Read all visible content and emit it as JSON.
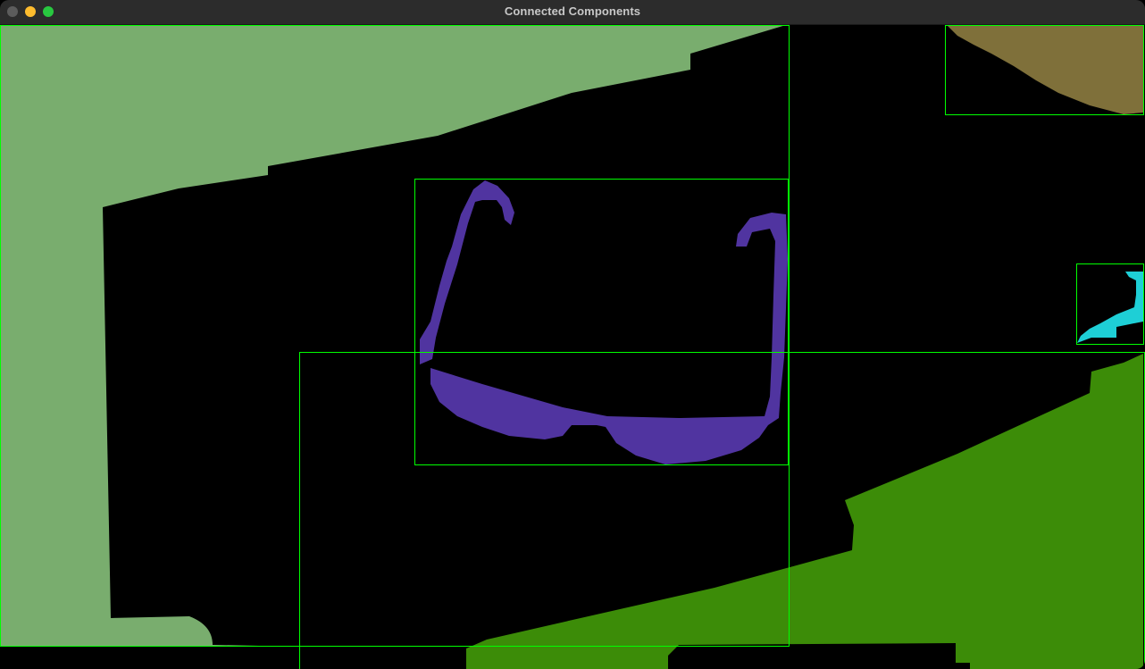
{
  "window": {
    "title": "Connected Components"
  },
  "colors": {
    "background": "#000000",
    "titlebar": "#2c2c2c",
    "bounding_box": "#00ff00",
    "component_light_green": "#79ad6e",
    "component_olive": "#7f703a",
    "component_purple": "#5034a0",
    "component_cyan": "#1ecfd6",
    "component_green": "#3c8c08"
  },
  "components": [
    {
      "name": "light-green-region",
      "color_key": "component_light_green"
    },
    {
      "name": "olive-region",
      "color_key": "component_olive"
    },
    {
      "name": "purple-glasses-region",
      "color_key": "component_purple"
    },
    {
      "name": "cyan-region",
      "color_key": "component_cyan"
    },
    {
      "name": "green-region",
      "color_key": "component_green"
    }
  ]
}
